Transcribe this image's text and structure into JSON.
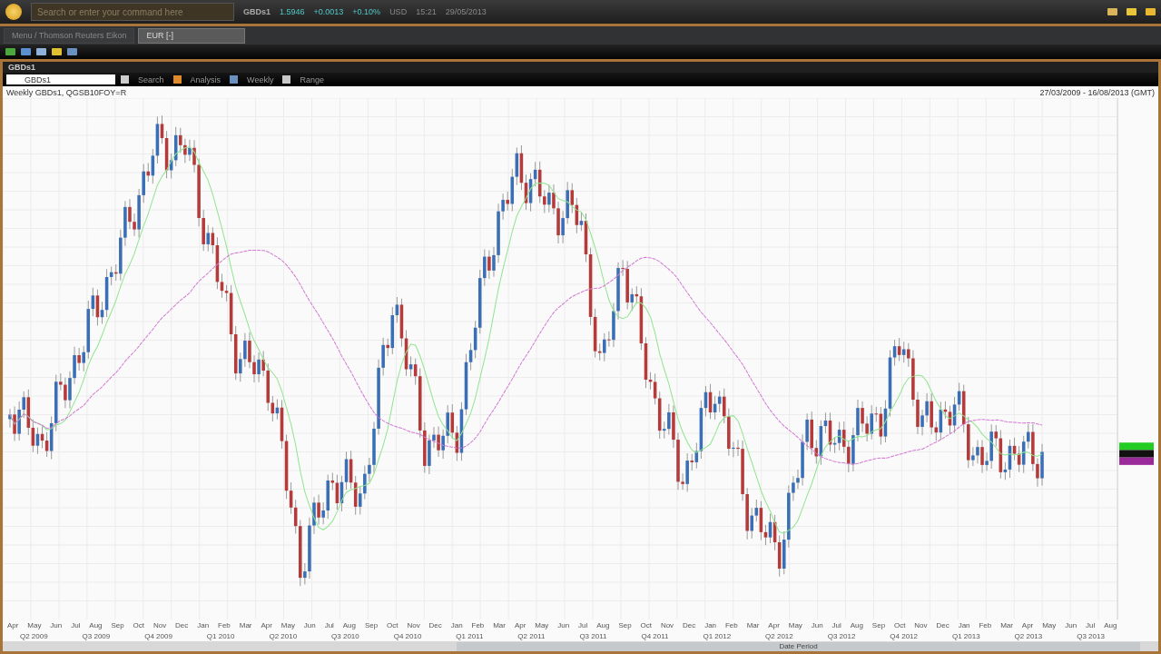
{
  "top_bar": {
    "search": {
      "placeholder": "Search or enter your command here"
    },
    "quote": {
      "symbol": "GBDs1",
      "last": "1.5946",
      "change": "+0.0013",
      "percent": "+0.10%",
      "currency": "USD",
      "time": "15:21",
      "date": "29/05/2013"
    }
  },
  "tabs": [
    {
      "label": "Menu / Thomson Reuters Eikon",
      "selected": false
    },
    {
      "label": "EUR [-]",
      "selected": true
    }
  ],
  "panel": {
    "title": "GBDs1",
    "instrument": "GBDs1",
    "toolbar": [
      {
        "label": "Search"
      },
      {
        "label": "Analysis"
      },
      {
        "label": "Weekly"
      },
      {
        "label": "Range"
      }
    ]
  },
  "chart": {
    "title": "Weekly GBDs1, QGSB10FOY=R",
    "range": "27/03/2009 - 16/08/2013 (GMT)",
    "months": [
      "Apr",
      "May",
      "Jun",
      "Jul",
      "Aug",
      "Sep",
      "Oct",
      "Nov",
      "Dec",
      "Jan",
      "Feb",
      "Mar",
      "Apr",
      "May",
      "Jun",
      "Jul",
      "Aug",
      "Sep",
      "Oct",
      "Nov",
      "Dec",
      "Jan",
      "Feb",
      "Mar",
      "Apr",
      "May",
      "Jun",
      "Jul",
      "Aug",
      "Sep",
      "Oct",
      "Nov",
      "Dec",
      "Jan",
      "Feb",
      "Mar",
      "Apr",
      "May",
      "Jun",
      "Jul",
      "Aug",
      "Sep",
      "Oct",
      "Nov",
      "Dec",
      "Jan",
      "Feb",
      "Mar",
      "Apr",
      "May",
      "Jun",
      "Jul",
      "Aug"
    ],
    "quarters": [
      "Q2 2009",
      "Q3 2009",
      "Q4 2009",
      "Q1 2010",
      "Q2 2010",
      "Q3 2010",
      "Q4 2010",
      "Q1 2011",
      "Q2 2011",
      "Q3 2011",
      "Q4 2011",
      "Q1 2012",
      "Q2 2012",
      "Q3 2012",
      "Q4 2012",
      "Q1 2013",
      "Q2 2013",
      "Q3 2013"
    ],
    "scrollbar_label": "Date Period"
  }
}
